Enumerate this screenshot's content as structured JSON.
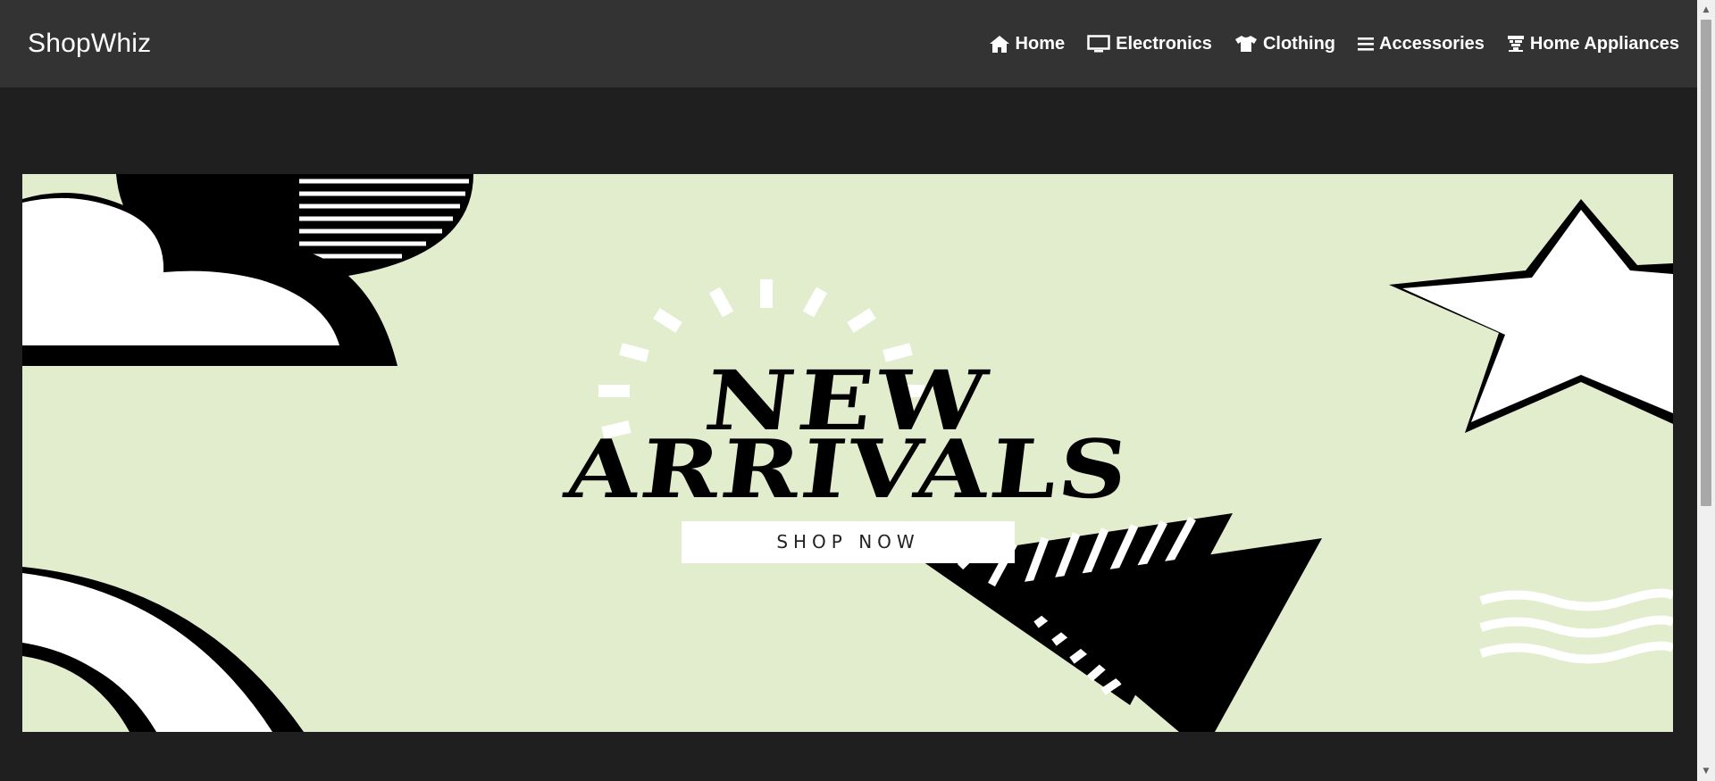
{
  "brand": {
    "name": "ShopWhiz"
  },
  "nav": {
    "items": [
      {
        "label": "Home",
        "icon": "home-icon"
      },
      {
        "label": "Electronics",
        "icon": "monitor-icon"
      },
      {
        "label": "Clothing",
        "icon": "shirt-icon"
      },
      {
        "label": "Accessories",
        "icon": "bars-icon"
      },
      {
        "label": "Home Appliances",
        "icon": "appliance-icon"
      }
    ]
  },
  "banner": {
    "headline_line1": "NEW",
    "headline_line2": "ARRIVALS",
    "button_label": "SHOP NOW"
  },
  "colors": {
    "navbar": "#333333",
    "page_background": "#1f1f1f",
    "banner_background": "#e1edcc",
    "text": "#ffffff"
  }
}
